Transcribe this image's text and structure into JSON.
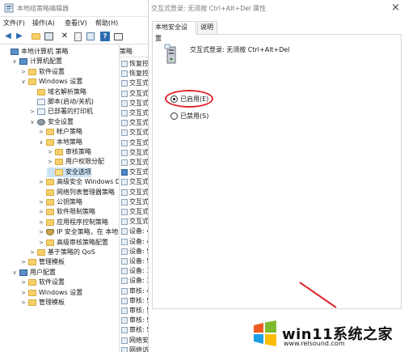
{
  "editor": {
    "title": "本地组策略编辑器",
    "menu": [
      "文件(F)",
      "操作(A)",
      "查看(V)",
      "帮助(H)"
    ],
    "toolbar_icons": [
      "back-arrow-icon",
      "forward-arrow-icon",
      "up-folder-icon",
      "show-hide-tree-icon",
      "delete-icon",
      "properties-icon",
      "export-icon",
      "help-icon",
      "console-icon"
    ],
    "tree": [
      {
        "label": "本地计算机 策略",
        "icon": "pc",
        "depth": 0,
        "twisty": ""
      },
      {
        "label": "计算机配置",
        "icon": "pc",
        "depth": 1,
        "twisty": "∨"
      },
      {
        "label": "软件设置",
        "icon": "folder",
        "depth": 2,
        "twisty": ">"
      },
      {
        "label": "Windows 设置",
        "icon": "folder",
        "depth": 2,
        "twisty": "∨"
      },
      {
        "label": "域名解析策略",
        "icon": "folder",
        "depth": 3,
        "twisty": ""
      },
      {
        "label": "脚本(启动/关机)",
        "icon": "doc",
        "depth": 3,
        "twisty": ""
      },
      {
        "label": "已部署的打印机",
        "icon": "doc",
        "depth": 3,
        "twisty": ">"
      },
      {
        "label": "安全设置",
        "icon": "gear",
        "depth": 3,
        "twisty": "∨"
      },
      {
        "label": "帐户策略",
        "icon": "folder",
        "depth": 4,
        "twisty": ">"
      },
      {
        "label": "本地策略",
        "icon": "folder",
        "depth": 4,
        "twisty": "∨"
      },
      {
        "label": "审核策略",
        "icon": "folder",
        "depth": 5,
        "twisty": ">"
      },
      {
        "label": "用户权限分配",
        "icon": "folder",
        "depth": 5,
        "twisty": ">"
      },
      {
        "label": "安全选项",
        "icon": "folder-open",
        "depth": 5,
        "twisty": "",
        "selected": true
      },
      {
        "label": "高级安全 Windows D",
        "icon": "folder",
        "depth": 4,
        "twisty": ">"
      },
      {
        "label": "网络列表管理器策略",
        "icon": "folder",
        "depth": 4,
        "twisty": ""
      },
      {
        "label": "公钥策略",
        "icon": "folder",
        "depth": 4,
        "twisty": ">"
      },
      {
        "label": "软件限制策略",
        "icon": "folder",
        "depth": 4,
        "twisty": ">"
      },
      {
        "label": "应用程序控制策略",
        "icon": "folder",
        "depth": 4,
        "twisty": ">"
      },
      {
        "label": "IP 安全策略，在 本地",
        "icon": "shield",
        "depth": 4,
        "twisty": ">"
      },
      {
        "label": "高级审核策略配置",
        "icon": "folder",
        "depth": 4,
        "twisty": ">"
      },
      {
        "label": "基于策略的 QoS",
        "icon": "folder",
        "depth": 3,
        "twisty": ">"
      },
      {
        "label": "管理模板",
        "icon": "folder",
        "depth": 2,
        "twisty": ">"
      },
      {
        "label": "用户配置",
        "icon": "pc",
        "depth": 1,
        "twisty": "∨"
      },
      {
        "label": "软件设置",
        "icon": "folder",
        "depth": 2,
        "twisty": ">"
      },
      {
        "label": "Windows 设置",
        "icon": "folder",
        "depth": 2,
        "twisty": ">"
      },
      {
        "label": "管理模板",
        "icon": "folder",
        "depth": 2,
        "twisty": ">"
      }
    ],
    "right_header": "策略",
    "right_items": [
      {
        "label": "恢复控",
        "blue": false
      },
      {
        "label": "恢复控",
        "blue": false
      },
      {
        "label": "交互式",
        "blue": false
      },
      {
        "label": "交互式",
        "blue": false
      },
      {
        "label": "交互式",
        "blue": false
      },
      {
        "label": "交互式",
        "blue": false
      },
      {
        "label": "交互式",
        "blue": false
      },
      {
        "label": "交互式",
        "blue": false
      },
      {
        "label": "交互式",
        "blue": false
      },
      {
        "label": "交互式",
        "blue": false
      },
      {
        "label": "交互式",
        "blue": false
      },
      {
        "label": "交互式",
        "blue": true
      },
      {
        "label": "交互式",
        "blue": false
      },
      {
        "label": "交互式",
        "blue": false
      },
      {
        "label": "交互式",
        "blue": false
      },
      {
        "label": "交互式",
        "blue": false
      },
      {
        "label": "交互式",
        "blue": false
      },
      {
        "label": "设备: 4",
        "blue": false
      },
      {
        "label": "设备: 4",
        "blue": false
      },
      {
        "label": "设备: 5",
        "blue": false
      },
      {
        "label": "设备: 5",
        "blue": false
      },
      {
        "label": "设备: 3",
        "blue": false
      },
      {
        "label": "设备: 3",
        "blue": false
      },
      {
        "label": "审核: 4",
        "blue": false
      },
      {
        "label": "审核: 5",
        "blue": false
      },
      {
        "label": "审核: 5",
        "blue": false
      },
      {
        "label": "审核: 5",
        "blue": false
      },
      {
        "label": "审核: 5",
        "blue": false
      },
      {
        "label": "网络安",
        "blue": false
      },
      {
        "label": "网络访",
        "blue": false
      }
    ]
  },
  "dialog": {
    "title": "交互式登录: 无须按 Ctrl+Alt+Del 属性",
    "close": "×",
    "tabs": [
      "本地安全设置",
      "说明"
    ],
    "policy_name": "交互式登录: 无须按 Ctrl+Alt+Del",
    "options": [
      {
        "label": "已启用(E)",
        "checked": true
      },
      {
        "label": "已禁用(S)",
        "checked": false
      }
    ]
  },
  "watermark": {
    "brand": "win11系统之家",
    "url": "www.relsound.com"
  },
  "colors": {
    "selection": "#cce4f7",
    "highlight_ring": "#e0262d",
    "folder": "#f6d06a"
  }
}
